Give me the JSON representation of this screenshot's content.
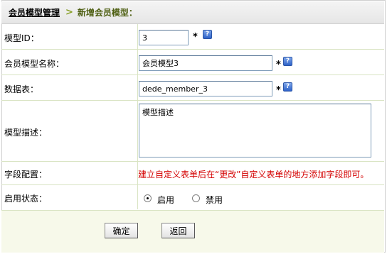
{
  "breadcrumb": {
    "root": "会员模型管理",
    "separator": ">",
    "current": "新增会员模型："
  },
  "form": {
    "model_id": {
      "label": "模型ID：",
      "value": "3",
      "required_mark": "*",
      "help_icon": "?"
    },
    "model_name": {
      "label": "会员模型名称：",
      "value": "会员模型3",
      "required_mark": "*",
      "help_icon": "?"
    },
    "data_table": {
      "label": "数据表：",
      "value": "dede_member_3",
      "required_mark": "*",
      "help_icon": "?"
    },
    "description": {
      "label": "模型描述：",
      "value": "模型描述"
    },
    "field_config": {
      "label": "字段配置：",
      "note": "建立自定义表单后在“更改”自定义表单的地方添加字段即可。"
    },
    "status": {
      "label": "启用状态：",
      "options": [
        {
          "label": "启用",
          "checked": true
        },
        {
          "label": "禁用",
          "checked": false
        }
      ]
    }
  },
  "buttons": {
    "confirm": "确定",
    "back": "返回"
  },
  "colors": {
    "note_red": "#d40000",
    "breadcrumb_current": "#4e5f12",
    "row_border": "#d9e4c3",
    "footer_bg": "#f7f9ea"
  }
}
